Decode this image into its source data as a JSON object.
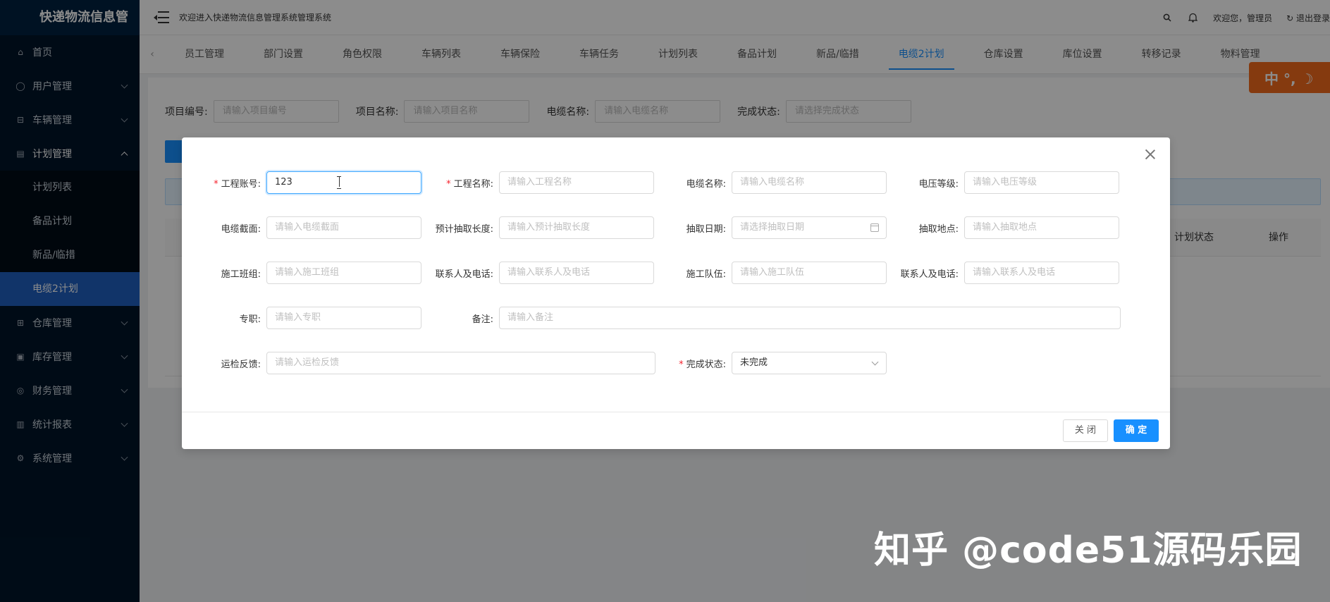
{
  "sidebar": {
    "brand": "快递物流信息管",
    "menu": [
      {
        "label": "首页",
        "icon": "home-icon"
      },
      {
        "label": "用户管理",
        "icon": "user-icon"
      },
      {
        "label": "车辆管理",
        "icon": "car-icon"
      },
      {
        "label": "计划管理",
        "icon": "document-icon"
      }
    ],
    "plan_sub": [
      "计划列表",
      "备品计划",
      "新品/临措",
      "电缆2计划"
    ],
    "menu2": [
      {
        "label": "仓库管理",
        "icon": "warehouse-icon"
      },
      {
        "label": "库存管理",
        "icon": "inventory-icon"
      },
      {
        "label": "财务管理",
        "icon": "finance-icon"
      },
      {
        "label": "统计报表",
        "icon": "chart-icon"
      },
      {
        "label": "系统管理",
        "icon": "gear-icon"
      }
    ]
  },
  "header": {
    "welcome": "欢迎进入快递物流信息管理系统管理系统",
    "greeting": "欢迎您，管理员",
    "logout": "退出登录"
  },
  "tabs": [
    "员工管理",
    "部门设置",
    "角色权限",
    "车辆列表",
    "车辆保险",
    "车辆任务",
    "计划列表",
    "备品计划",
    "新品/临措",
    "电缆2计划",
    "仓库设置",
    "库位设置",
    "转移记录",
    "物料管理"
  ],
  "active_tab": "电缆2计划",
  "ime": "中 °, ☽",
  "search": {
    "project_no_label": "项目编号:",
    "project_no_ph": "请输入项目编号",
    "project_name_label": "项目名称:",
    "project_name_ph": "请输入项目名称",
    "cable_name_label": "电缆名称:",
    "cable_name_ph": "请输入电缆名称",
    "status_label": "完成状态:",
    "status_ph": "请选择完成状态"
  },
  "table": {
    "col_status": "计划状态",
    "col_action": "操作"
  },
  "modal": {
    "fields": {
      "account_label": "工程账号:",
      "account_value": "123",
      "eng_name_label": "工程名称:",
      "eng_name_ph": "请输入工程名称",
      "cable_name_label": "电缆名称:",
      "cable_name_ph": "请输入电缆名称",
      "voltage_label": "电压等级:",
      "voltage_ph": "请输入电压等级",
      "section_label": "电缆截面:",
      "section_ph": "请输入电缆截面",
      "length_label": "预计抽取长度:",
      "length_ph": "请输入预计抽取长度",
      "date_label": "抽取日期:",
      "date_ph": "请选择抽取日期",
      "place_label": "抽取地点:",
      "place_ph": "请输入抽取地点",
      "team_label": "施工班组:",
      "team_ph": "请输入施工班组",
      "contact1_label": "联系人及电话:",
      "contact1_ph": "请输入联系人及电话",
      "crew_label": "施工队伍:",
      "crew_ph": "请输入施工队伍",
      "contact2_label": "联系人及电话:",
      "contact2_ph": "请输入联系人及电话",
      "special_label": "专职:",
      "special_ph": "请输入专职",
      "remark_label": "备注:",
      "remark_ph": "请输入备注",
      "feedback_label": "运检反馈:",
      "feedback_ph": "请输入运检反馈",
      "status_label": "完成状态:",
      "status_value": "未完成"
    },
    "cancel_label": "关 闭",
    "ok_label": "确 定"
  },
  "watermark": "知乎 @code51源码乐园"
}
